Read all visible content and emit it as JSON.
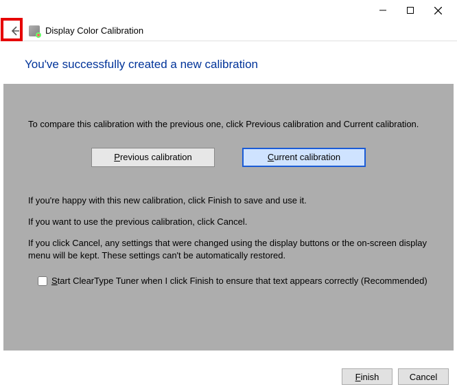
{
  "window": {
    "title": "Display Color Calibration"
  },
  "heading": "You've successfully created a new calibration",
  "body": {
    "compare_text": "To compare this calibration with the previous one, click Previous calibration and Current calibration.",
    "prev_btn_prefix": "P",
    "prev_btn_rest": "revious calibration",
    "curr_btn_prefix": "C",
    "curr_btn_rest": "urrent calibration",
    "happy_text": "If you're happy with this new calibration, click Finish to save and use it.",
    "use_prev_text": "If you want to use the previous calibration, click Cancel.",
    "cancel_warning": "If you click Cancel, any settings that were changed using the display buttons or the on-screen display menu will be kept. These settings can't be automatically restored.",
    "cleartype_prefix": "S",
    "cleartype_rest": "tart ClearType Tuner when I click Finish to ensure that text appears correctly (Recommended)"
  },
  "footer": {
    "finish_prefix": "F",
    "finish_rest": "inish",
    "cancel": "Cancel"
  }
}
